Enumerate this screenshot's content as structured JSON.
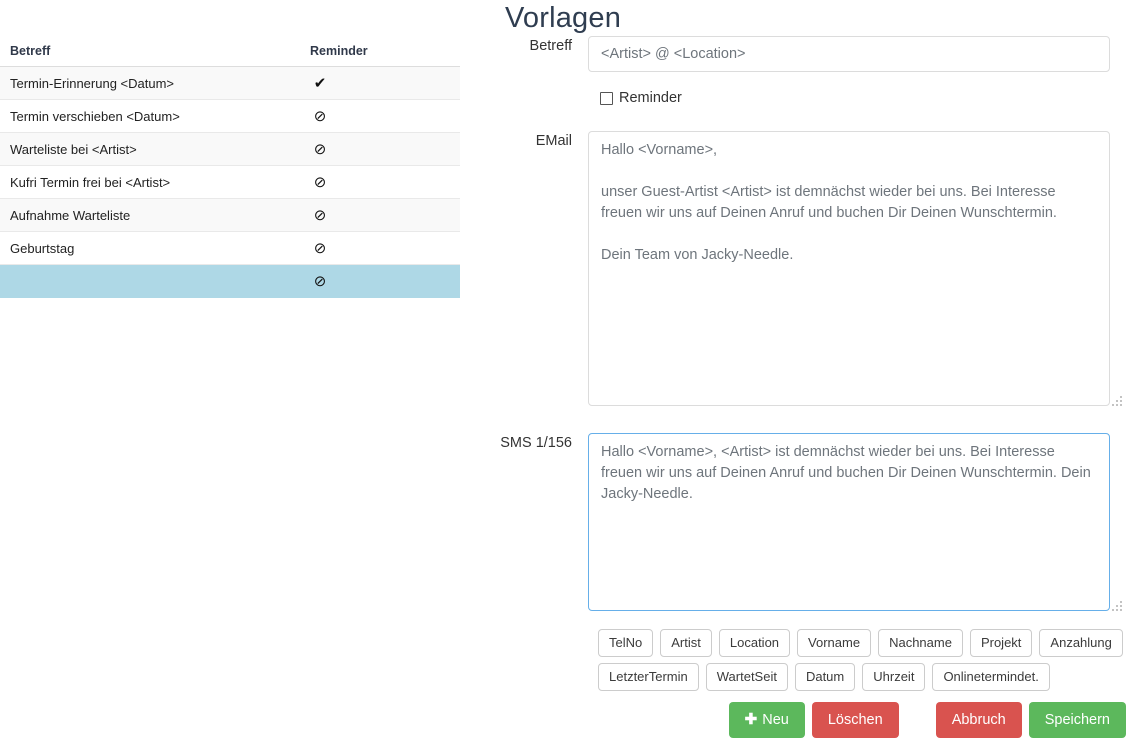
{
  "page": {
    "title": "Vorlagen"
  },
  "template_list": {
    "columns": {
      "subject": "Betreff",
      "reminder": "Reminder"
    },
    "icons": {
      "check": "✔",
      "blocked": "⊘"
    },
    "rows": [
      {
        "subject": "Termin-Erinnerung <Datum>",
        "reminder": "✔",
        "reminder_icon": "check-icon",
        "selected": false
      },
      {
        "subject": "Termin verschieben <Datum>",
        "reminder": "⊘",
        "reminder_icon": "blocked-icon",
        "selected": false
      },
      {
        "subject": "Warteliste bei <Artist>",
        "reminder": "⊘",
        "reminder_icon": "blocked-icon",
        "selected": false
      },
      {
        "subject": "Kufri Termin frei bei <Artist>",
        "reminder": "⊘",
        "reminder_icon": "blocked-icon",
        "selected": false
      },
      {
        "subject": "Aufnahme Warteliste",
        "reminder": "⊘",
        "reminder_icon": "blocked-icon",
        "selected": false
      },
      {
        "subject": "Geburtstag",
        "reminder": "⊘",
        "reminder_icon": "blocked-icon",
        "selected": false
      },
      {
        "subject": "",
        "reminder": "⊘",
        "reminder_icon": "blocked-icon",
        "selected": true
      }
    ]
  },
  "form": {
    "subject": {
      "label": "Betreff",
      "value": "<Artist> @ <Location>"
    },
    "reminder": {
      "label": "Reminder",
      "checked": false
    },
    "email": {
      "label": "EMail",
      "value": "Hallo <Vorname>,\n\nunser Guest-Artist <Artist> ist demnächst wieder bei uns. Bei Interesse freuen wir uns auf Deinen Anruf und buchen Dir Deinen Wunschtermin.\n\nDein Team von Jacky-Needle."
    },
    "sms": {
      "label": "SMS 1/156",
      "value": "Hallo <Vorname>, <Artist> ist demnächst wieder bei uns. Bei Interesse freuen wir uns auf Deinen Anruf und buchen Dir Deinen Wunschtermin. Dein Jacky-Needle."
    }
  },
  "tokens": [
    "TelNo",
    "Artist",
    "Location",
    "Vorname",
    "Nachname",
    "Projekt",
    "Anzahlung",
    "LetzterTermin",
    "WartetSeit",
    "Datum",
    "Uhrzeit",
    "Onlinetermindet."
  ],
  "actions": {
    "new": "Neu",
    "new_icon": "✚",
    "delete": "Löschen",
    "cancel": "Abbruch",
    "save": "Speichern"
  },
  "colors": {
    "green": "#5cb85c",
    "red": "#d9534f",
    "selected_row": "#aed8e6",
    "focus_border": "#66afe9",
    "title": "#2f3d50"
  }
}
